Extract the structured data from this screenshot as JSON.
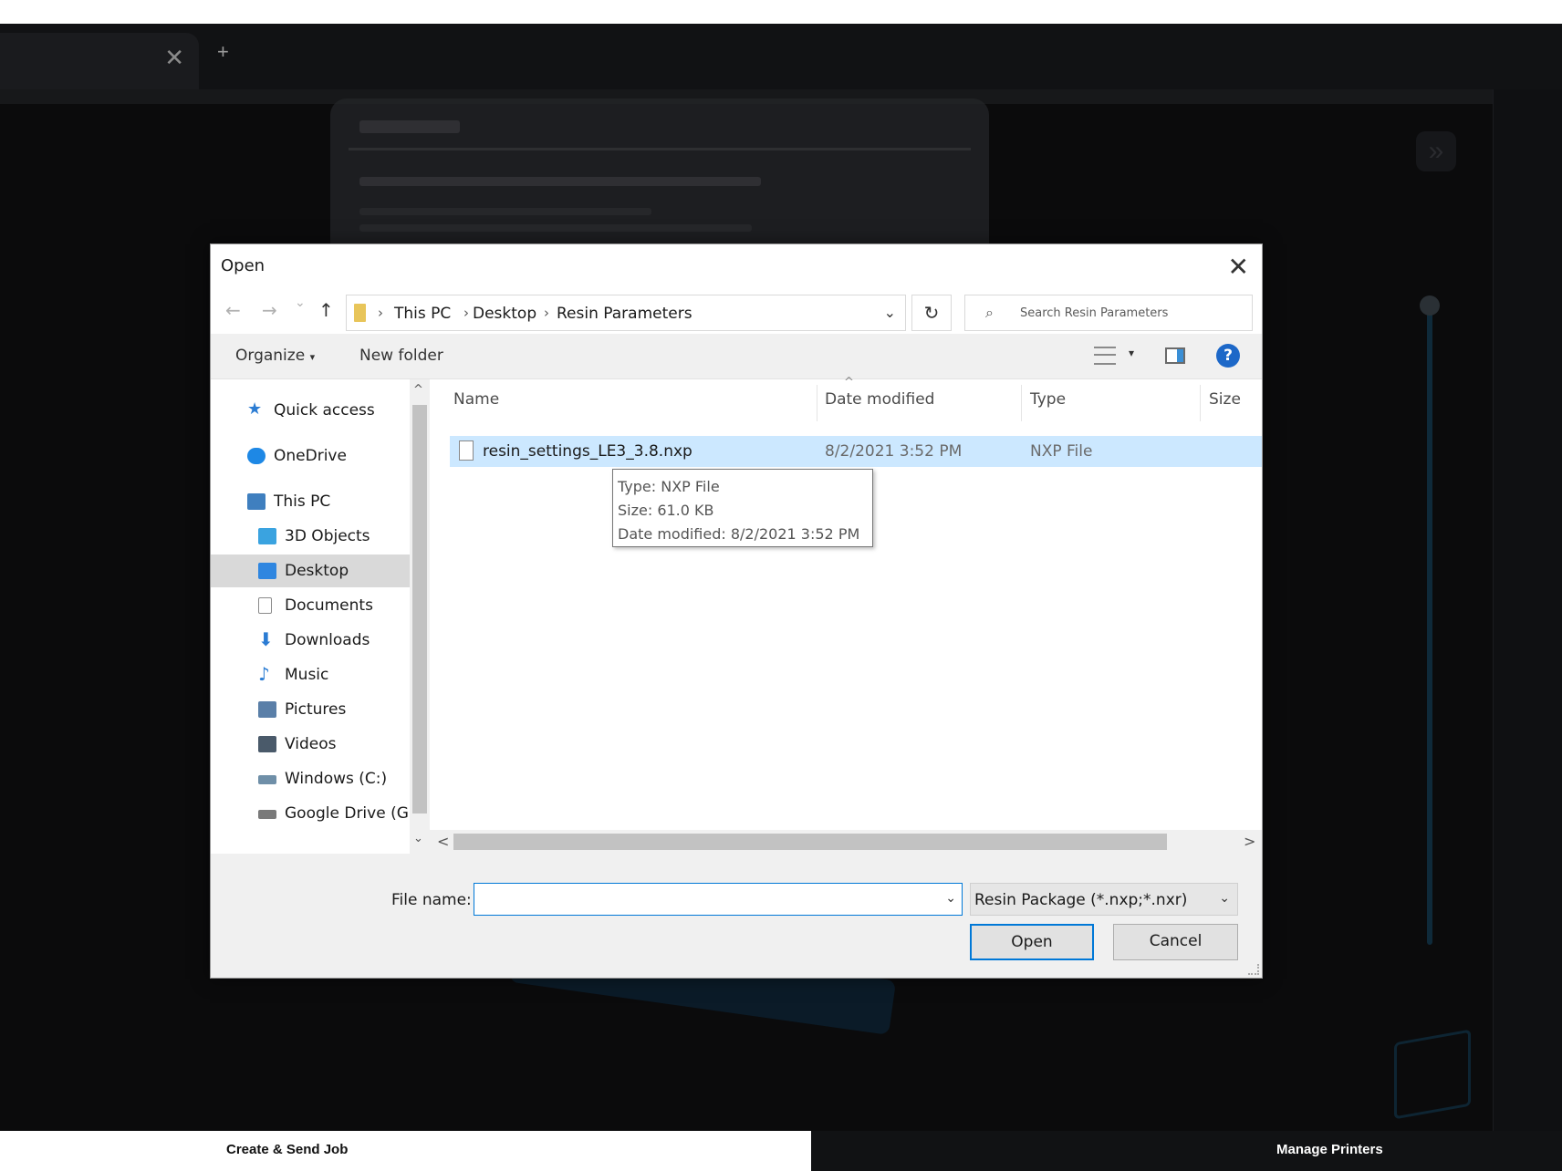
{
  "app": {
    "tab_close_glyph": "✕",
    "tab_add_glyph": "+",
    "bottom_nav": {
      "create_send_job": "Create & Send Job",
      "manage_printers": "Manage Printers"
    }
  },
  "dialog": {
    "title": "Open",
    "close_glyph": "✕",
    "nav": {
      "back_glyph": "←",
      "forward_glyph": "→",
      "recent_glyph": "⌄",
      "up_glyph": "↑"
    },
    "breadcrumb": [
      "This PC",
      "Desktop",
      "Resin Parameters"
    ],
    "breadcrumb_sep": "›",
    "address_dropdown_glyph": "⌄",
    "refresh_glyph": "↻",
    "search": {
      "icon_glyph": "⌕",
      "placeholder": "Search Resin Parameters"
    },
    "toolbar": {
      "organize_label": "Organize",
      "organize_caret": "▾",
      "new_folder_label": "New folder",
      "view_caret": "▾",
      "help_glyph": "?"
    },
    "nav_pane": {
      "items": [
        {
          "label": "Quick access",
          "icon": "star-icon",
          "color": "#2b7cd3",
          "indent": 0,
          "selected": false
        },
        {
          "label": "OneDrive",
          "icon": "cloud-icon",
          "color": "#1e88e5",
          "indent": 0,
          "selected": false
        },
        {
          "label": "This PC",
          "icon": "computer-icon",
          "color": "#3f7fbf",
          "indent": 0,
          "selected": false
        },
        {
          "label": "3D Objects",
          "icon": "cube-icon",
          "color": "#3aa3e0",
          "indent": 1,
          "selected": false
        },
        {
          "label": "Desktop",
          "icon": "desktop-icon",
          "color": "#2f86e0",
          "indent": 1,
          "selected": true
        },
        {
          "label": "Documents",
          "icon": "document-icon",
          "color": "#8a8a8a",
          "indent": 1,
          "selected": false
        },
        {
          "label": "Downloads",
          "icon": "download-icon",
          "color": "#2b7cd3",
          "indent": 1,
          "selected": false
        },
        {
          "label": "Music",
          "icon": "music-icon",
          "color": "#2b7cd3",
          "indent": 1,
          "selected": false
        },
        {
          "label": "Pictures",
          "icon": "pictures-icon",
          "color": "#5a7fa8",
          "indent": 1,
          "selected": false
        },
        {
          "label": "Videos",
          "icon": "video-icon",
          "color": "#4a5a6a",
          "indent": 1,
          "selected": false
        },
        {
          "label": "Windows (C:)",
          "icon": "drive-icon",
          "color": "#6f8fa8",
          "indent": 1,
          "selected": false
        },
        {
          "label": "Google Drive (G:)",
          "icon": "drive-icon",
          "color": "#7a7a7a",
          "indent": 1,
          "selected": false
        }
      ],
      "scroll_up_glyph": "^",
      "scroll_down_glyph": "⌄"
    },
    "columns": {
      "name": "Name",
      "date_modified": "Date modified",
      "type": "Type",
      "size": "Size",
      "sort_caret": "^"
    },
    "files": [
      {
        "name": "resin_settings_LE3_3.8.nxp",
        "date_modified": "8/2/2021 3:52 PM",
        "type": "NXP File",
        "size": ""
      }
    ],
    "tooltip": {
      "type_line": "Type: NXP File",
      "size_line": "Size: 61.0 KB",
      "date_line": "Date modified: 8/2/2021 3:52 PM"
    },
    "hscroll": {
      "left_glyph": "<",
      "right_glyph": ">"
    },
    "footer": {
      "file_name_label": "File name:",
      "file_name_value": "",
      "file_name_dropdown_glyph": "⌄",
      "filter_value": "Resin Package (*.nxp;*.nxr)",
      "filter_dropdown_glyph": "⌄",
      "open_label": "Open",
      "cancel_label": "Cancel"
    }
  }
}
